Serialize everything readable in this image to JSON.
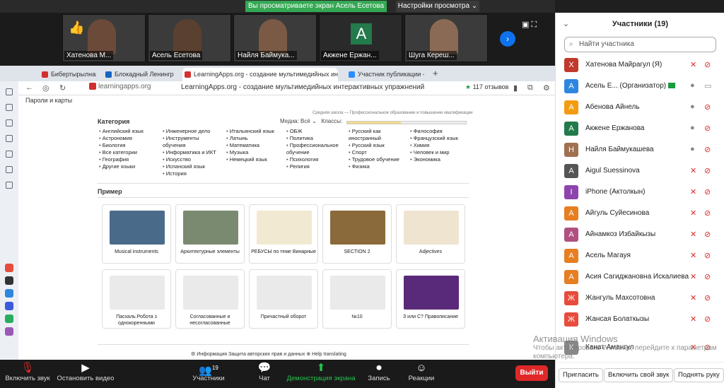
{
  "zoom_top": {
    "share_banner": "Вы просматриваете экран Асель Есетова",
    "view_settings": "Настройки просмотра ⌄"
  },
  "video_tiles": [
    {
      "name": "Хатенова М...",
      "kind": "video"
    },
    {
      "name": "Асель Есетова",
      "kind": "video"
    },
    {
      "name": "Найля Баймука...",
      "kind": "video"
    },
    {
      "name": "Акжене Ержан...",
      "kind": "avatar",
      "initial": "A"
    },
    {
      "name": "Шуга Кереш...",
      "kind": "video"
    }
  ],
  "browser": {
    "tabs": [
      "Бибертырылнайте И.Л...",
      "Блокадный Ленинград",
      "LearningApps.org - создание мультимедийных интерактивных упражнений",
      "Участник публикации - Zoom"
    ],
    "url": "learningapps.org",
    "title": "LearningApps.org - создание мультимедийных интерактивных упражнений",
    "reviews": "117 отзывов",
    "bookmarks": "Пароли и карты"
  },
  "learningapps": {
    "category_label": "Категория",
    "meta": "Средняя школа — Профессиональное образование и повышение квалификации",
    "media_label": "Медиа: Всё",
    "classes_label": "Классы:",
    "classes_fraction": 0.45,
    "columns": [
      [
        "Английский язык",
        "Астрономия",
        "Биология",
        "Все категории",
        "География",
        "Другие языки"
      ],
      [
        "Инженерное дело",
        "Инструменты обучения",
        "Информатика и ИКТ",
        "Искусство",
        "Испанский язык",
        "История"
      ],
      [
        "Итальянский язык",
        "Латынь",
        "Математика",
        "Музыка",
        "Немецкий язык"
      ],
      [
        "ОБЖ",
        "Политика",
        "Профессиональное обучение",
        "Психология",
        "Религия"
      ],
      [
        "Русский как иностранный",
        "Русский язык",
        "Спорт",
        "Трудовое обучение",
        "Физика"
      ],
      [
        "Философия",
        "Французский язык",
        "Химия",
        "Человек и мир",
        "Экономика"
      ]
    ],
    "example_label": "Пример",
    "cards": [
      {
        "caption": "Musical instruments",
        "color": "#4a6a8a"
      },
      {
        "caption": "Архитектурные элементы",
        "color": "#7a8a70"
      },
      {
        "caption": "РЕБУСЫ по теме Винарные",
        "color": "#f2e9d2"
      },
      {
        "caption": "SECTION 2",
        "color": "#8a6a3a"
      },
      {
        "caption": "Adjectives",
        "color": "#efe4d0"
      },
      {
        "caption": "Пасхаль.Робота з однокоренными",
        "color": "#eaeaea"
      },
      {
        "caption": "Согласованные и несогласованные",
        "color": "#eaeaea"
      },
      {
        "caption": "Причастный оборот",
        "color": "#eaeaea"
      },
      {
        "caption": "№10",
        "color": "#eaeaea"
      },
      {
        "caption": "З или С? Правописание",
        "color": "#5a2a7a"
      }
    ],
    "footer": "⚙ Информация     Защита авторских прав и данных     ⊕ Help translating"
  },
  "watermark": {
    "title": "Активация Windows",
    "sub": "Чтобы активировать Windows, перейдите к параметрам компьютера."
  },
  "zoom_bottom": {
    "mute": "Включить звук",
    "video": "Остановить видео",
    "participants": "Участники",
    "participants_count": "19",
    "chat": "Чат",
    "share": "Демонстрация экрана",
    "record": "Запись",
    "reactions": "Реакции",
    "leave": "Выйти"
  },
  "panel": {
    "title": "Участники (19)",
    "search_placeholder": "Найти участника",
    "participants": [
      {
        "initial": "Х",
        "color": "#c0392b",
        "name": "Хатенова Майрагул (Я)",
        "mic": "off",
        "cam": "off"
      },
      {
        "initial": "A",
        "color": "#2e86de",
        "name": "Асель Е... (Организатор)",
        "mic": "on",
        "cam": "on",
        "host": true
      },
      {
        "initial": "A",
        "color": "#f39c12",
        "name": "Абенова Айнель",
        "mic": "on",
        "cam": "off"
      },
      {
        "initial": "A",
        "color": "#237a4a",
        "name": "Акженe Ержанова",
        "mic": "on",
        "cam": "off"
      },
      {
        "initial": "Н",
        "color": "#a07050",
        "name": "Найля Баймукашева",
        "mic": "on",
        "cam": "off"
      },
      {
        "initial": "A",
        "color": "#555",
        "name": "Aigul Suessinova",
        "mic": "off",
        "cam": "off"
      },
      {
        "initial": "I",
        "color": "#8e44ad",
        "name": "iPhone (Актолкын)",
        "mic": "off",
        "cam": "off"
      },
      {
        "initial": "A",
        "color": "#e67e22",
        "name": "Айгуль Суйесинова",
        "mic": "off",
        "cam": "off"
      },
      {
        "initial": "A",
        "color": "#b05080",
        "name": "Айнамкоз Избайкызы",
        "mic": "off",
        "cam": "off"
      },
      {
        "initial": "A",
        "color": "#e67e22",
        "name": "Асель Магауя",
        "mic": "off",
        "cam": "off"
      },
      {
        "initial": "A",
        "color": "#e67e22",
        "name": "Асия Сагиджановна Искалиева",
        "mic": "off",
        "cam": "off"
      },
      {
        "initial": "Ж",
        "color": "#e74c3c",
        "name": "Жангуль Махсотовна",
        "mic": "off",
        "cam": "off"
      },
      {
        "initial": "Ж",
        "color": "#e74c3c",
        "name": "Жансая Болаткызы",
        "mic": "off",
        "cam": "off"
      },
      {
        "initial": "К",
        "color": "#888",
        "name": "Канат Амангул",
        "mic": "off",
        "cam": "off"
      }
    ],
    "invite": "Пригласить",
    "unmute_self": "Включить свой звук",
    "raise_hand": "Поднять руку"
  }
}
